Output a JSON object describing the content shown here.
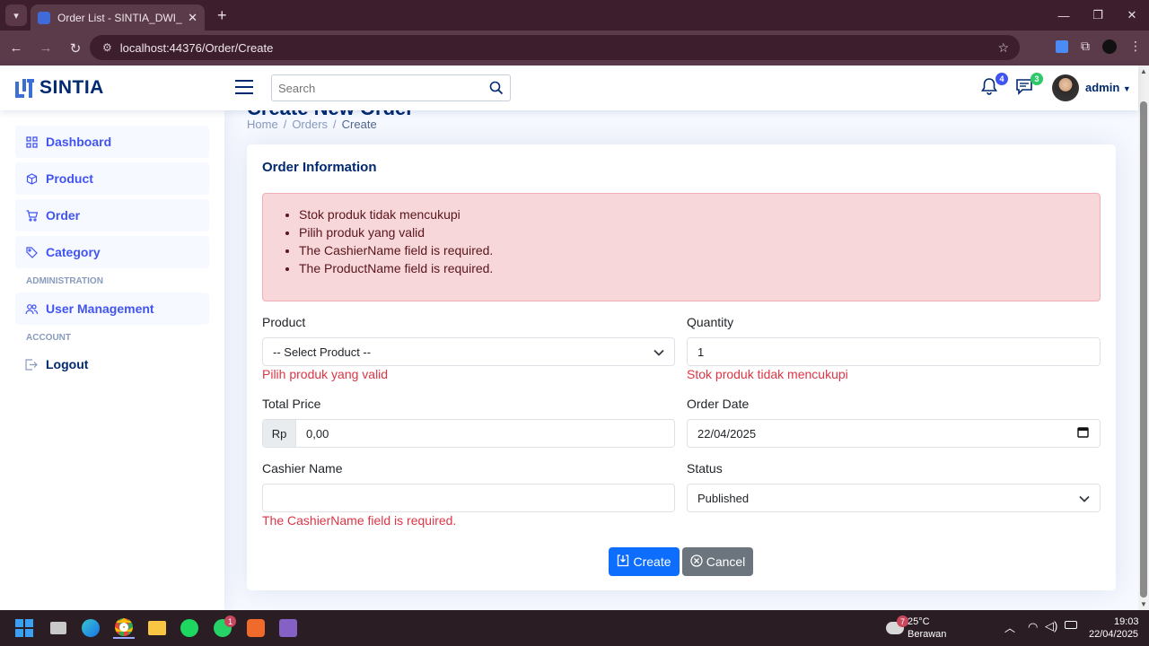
{
  "browser": {
    "tab_title": "Order List - SINTIA_DWI_ARGA",
    "url": "localhost:44376/Order/Create"
  },
  "header": {
    "brand": "SINTIA",
    "search_placeholder": "Search",
    "notifications_count": "4",
    "messages_count": "3",
    "username": "admin"
  },
  "sidebar": {
    "items": [
      {
        "label": "Dashboard",
        "icon": "grid-icon"
      },
      {
        "label": "Product",
        "icon": "box-icon"
      },
      {
        "label": "Order",
        "icon": "cart-icon"
      },
      {
        "label": "Category",
        "icon": "tags-icon"
      }
    ],
    "admin_heading": "ADMINISTRATION",
    "admin_items": [
      {
        "label": "User Management",
        "icon": "people-icon"
      }
    ],
    "account_heading": "ACCOUNT",
    "account_items": [
      {
        "label": "Logout",
        "icon": "logout-icon"
      }
    ]
  },
  "page": {
    "title": "Create New Order",
    "breadcrumb": [
      "Home",
      "Orders",
      "Create"
    ]
  },
  "form": {
    "card_title": "Order Information",
    "errors": [
      "Stok produk tidak mencukupi",
      "Pilih produk yang valid",
      "The CashierName field is required.",
      "The ProductName field is required."
    ],
    "product": {
      "label": "Product",
      "value": "-- Select Product --",
      "error": "Pilih produk yang valid"
    },
    "quantity": {
      "label": "Quantity",
      "value": "1",
      "error": "Stok produk tidak mencukupi"
    },
    "total_price": {
      "label": "Total Price",
      "prefix": "Rp",
      "value": "0,00"
    },
    "order_date": {
      "label": "Order Date",
      "value": "22/04/2025"
    },
    "cashier": {
      "label": "Cashier Name",
      "value": "",
      "error": "The CashierName field is required."
    },
    "status": {
      "label": "Status",
      "value": "Published"
    },
    "create_label": "Create",
    "cancel_label": "Cancel"
  },
  "taskbar": {
    "weather_temp": "25°C",
    "weather_desc": "Berawan",
    "weather_badge": "7",
    "whatsapp_badge": "1",
    "time": "19:03",
    "date": "22/04/2025"
  },
  "colors": {
    "brand": "#012970",
    "primary": "#0d6efd",
    "secondary": "#6c757d",
    "danger": "#dc3545",
    "badge_blue": "#4154f1",
    "badge_green": "#2eca6a"
  }
}
